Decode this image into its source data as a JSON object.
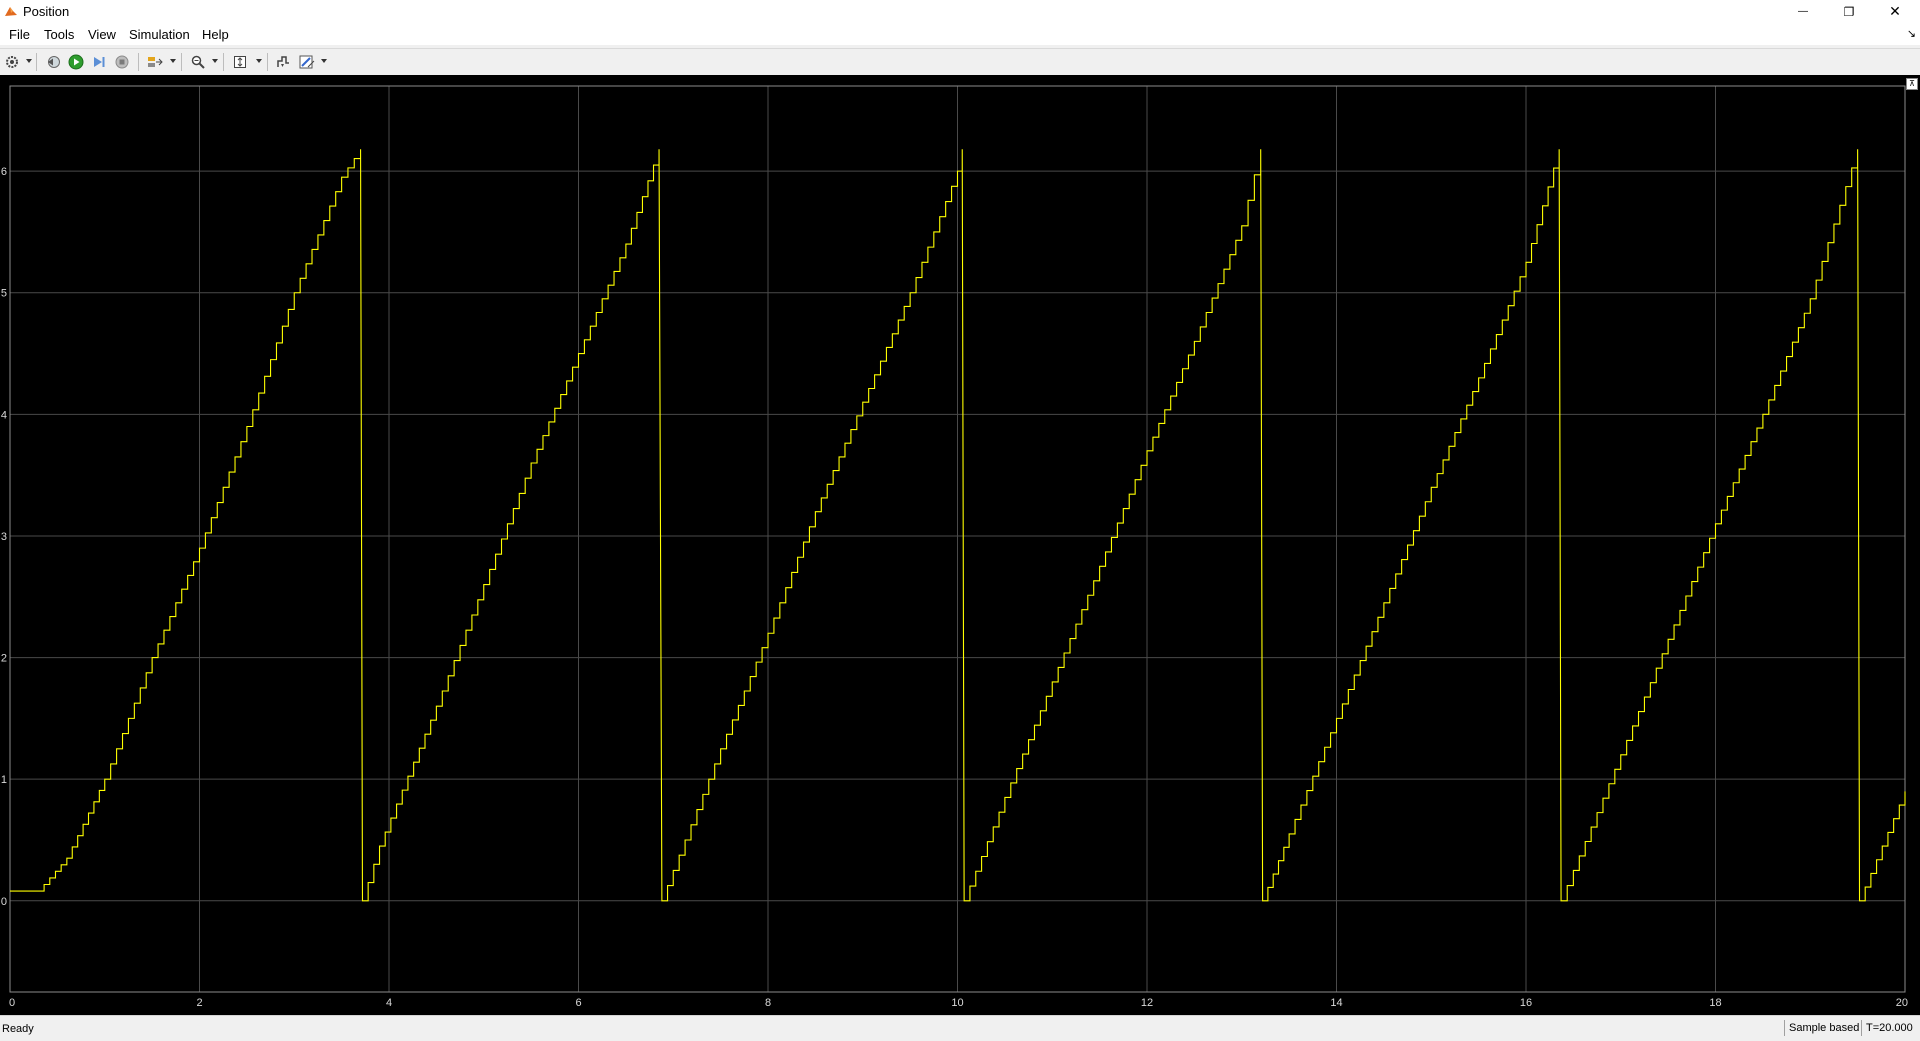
{
  "window": {
    "title": "Position",
    "minimize_glyph": "—",
    "restore_glyph": "❐",
    "close_glyph": "✕"
  },
  "menu": {
    "items": [
      "File",
      "Tools",
      "View",
      "Simulation",
      "Help"
    ],
    "undock_glyph": "↘"
  },
  "toolbar": {
    "buttons": [
      {
        "name": "settings-gear-icon",
        "dropdown": true
      },
      {
        "name": "step-back-icon",
        "dropdown": false
      },
      {
        "name": "run-icon",
        "dropdown": false
      },
      {
        "name": "step-forward-icon",
        "dropdown": false
      },
      {
        "name": "stop-icon",
        "dropdown": false
      },
      {
        "name": "highlight-signal-icon",
        "dropdown": true
      },
      {
        "name": "zoom-icon",
        "dropdown": true
      },
      {
        "name": "scale-axes-icon",
        "dropdown": true
      },
      {
        "name": "triggers-icon",
        "dropdown": false
      },
      {
        "name": "measurements-icon",
        "dropdown": true
      }
    ]
  },
  "status": {
    "ready": "Ready",
    "mode": "Sample based",
    "time": "T=20.000"
  },
  "colors": {
    "plot_background": "#000000",
    "grid": "#4a4a4a",
    "signal": "#ffff00",
    "tick_label": "#d9d9d9"
  },
  "chart_data": {
    "type": "line",
    "title": "",
    "xlabel": "",
    "ylabel": "",
    "xlim": [
      0,
      20
    ],
    "ylim": [
      -0.75,
      6.7
    ],
    "xticks": [
      "0",
      "2",
      "4",
      "6",
      "8",
      "10",
      "12",
      "14",
      "16",
      "18",
      "20"
    ],
    "yticks": [
      "0",
      "1",
      "2",
      "3",
      "4",
      "5",
      "6"
    ],
    "grid": true,
    "stairs": true,
    "series": [
      {
        "name": "",
        "color": "#ffff00",
        "points": [
          [
            0,
            0.08
          ],
          [
            0.3,
            0.08
          ],
          [
            0.6,
            0.35
          ],
          [
            1.0,
            1.0
          ],
          [
            1.5,
            2.0
          ],
          [
            2.0,
            2.9
          ],
          [
            2.5,
            3.9
          ],
          [
            3.0,
            5.0
          ],
          [
            3.5,
            5.95
          ],
          [
            3.7,
            6.18
          ],
          [
            3.72,
            0.0
          ],
          [
            3.9,
            0.45
          ],
          [
            4.5,
            1.6
          ],
          [
            5.0,
            2.6
          ],
          [
            5.5,
            3.6
          ],
          [
            6.0,
            4.5
          ],
          [
            6.5,
            5.4
          ],
          [
            6.85,
            6.18
          ],
          [
            6.88,
            0.0
          ],
          [
            7.0,
            0.25
          ],
          [
            7.5,
            1.25
          ],
          [
            8.0,
            2.2
          ],
          [
            8.5,
            3.2
          ],
          [
            9.0,
            4.1
          ],
          [
            9.5,
            5.0
          ],
          [
            10.0,
            6.0
          ],
          [
            10.05,
            6.18
          ],
          [
            10.07,
            0.0
          ],
          [
            10.5,
            0.85
          ],
          [
            11.0,
            1.8
          ],
          [
            11.5,
            2.75
          ],
          [
            12.0,
            3.7
          ],
          [
            12.5,
            4.6
          ],
          [
            13.0,
            5.55
          ],
          [
            13.2,
            6.18
          ],
          [
            13.22,
            0.0
          ],
          [
            13.5,
            0.55
          ],
          [
            14.0,
            1.5
          ],
          [
            14.5,
            2.45
          ],
          [
            15.0,
            3.4
          ],
          [
            15.5,
            4.3
          ],
          [
            16.0,
            5.25
          ],
          [
            16.35,
            6.18
          ],
          [
            16.37,
            0.0
          ],
          [
            16.5,
            0.25
          ],
          [
            17.0,
            1.2
          ],
          [
            17.5,
            2.15
          ],
          [
            18.0,
            3.1
          ],
          [
            18.5,
            4.0
          ],
          [
            19.0,
            4.95
          ],
          [
            19.5,
            6.18
          ],
          [
            19.52,
            0.0
          ],
          [
            20.0,
            0.9
          ]
        ]
      }
    ]
  }
}
